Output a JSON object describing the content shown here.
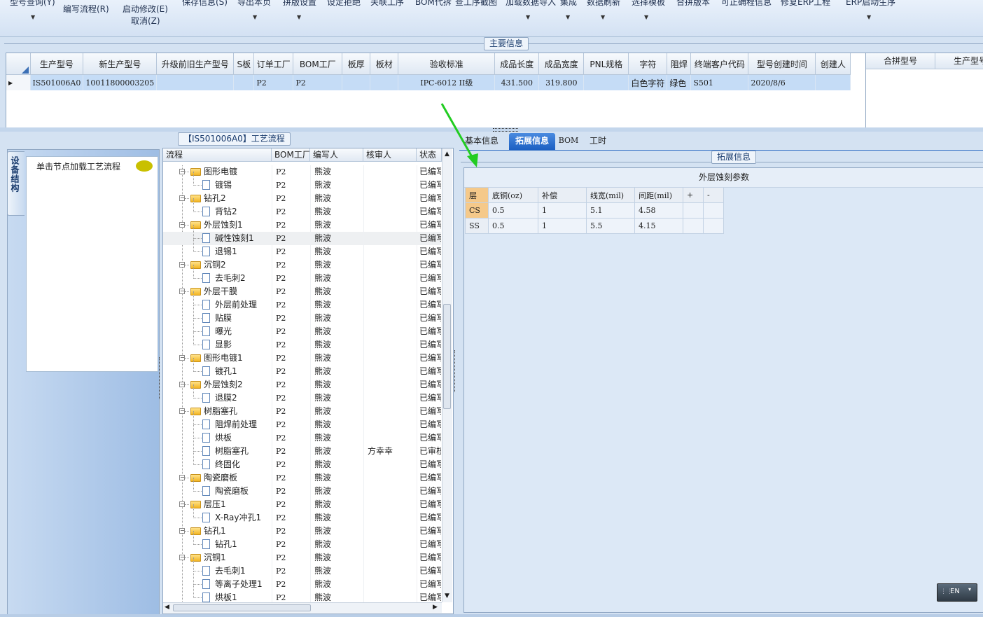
{
  "ribbon": {
    "top_items": [
      "型号查询(Y)",
      "保存信息(S)",
      "导出本页",
      "拼版设置",
      "设定拒绝",
      "关联工序",
      "BOM代拆",
      "查工序截图",
      "加载数据导入",
      "集成",
      "数据刷新",
      "选择模板",
      "合拼版本",
      "可正确程信息",
      "修复ERP工程",
      "ERP启动生序"
    ],
    "buttons": [
      {
        "label": "编写流程(R)"
      },
      {
        "label": "启动修改(E)",
        "sub": "取消(Z)"
      }
    ]
  },
  "main_info": {
    "title": "主要信息",
    "columns": [
      "生产型号",
      "新生产型号",
      "升级前旧生产型号",
      "S板",
      "订单工厂",
      "BOM工厂",
      "板厚",
      "板材",
      "验收标准",
      "成品长度",
      "成品宽度",
      "PNL规格",
      "字符",
      "阻焊",
      "终端客户代码",
      "型号创建时间",
      "创建人"
    ],
    "row": {
      "model": "IS501006A0",
      "new_model": "10011800003205",
      "old_model": "",
      "s_board": "",
      "order_factory": "P2",
      "bom_factory": "P2",
      "thickness": "",
      "material": "",
      "standard": "IPC-6012 II级",
      "length": "431.500",
      "width": "319.800",
      "pnl": "",
      "char": "白色字符",
      "mask": "绿色",
      "customer": "S501",
      "created": "2020/8/6",
      "creator": ""
    },
    "side_columns": [
      "合拼型号",
      "生产型号"
    ]
  },
  "left": {
    "vertical_tab": "设备结构",
    "hint": "单击节点加载工艺流程"
  },
  "process": {
    "title": "【IS501006A0】工艺流程",
    "columns": [
      "流程",
      "BOM工厂",
      "编写人",
      "核审人",
      "状态"
    ],
    "rows": [
      {
        "name": "图形电镀",
        "type": "folder",
        "bom": "P2",
        "writer": "熊波",
        "reviewer": "",
        "status": "已编写"
      },
      {
        "name": "镀锡",
        "type": "doc",
        "bom": "P2",
        "writer": "熊波",
        "reviewer": "",
        "status": "已编写"
      },
      {
        "name": "钻孔2",
        "type": "folder",
        "bom": "P2",
        "writer": "熊波",
        "reviewer": "",
        "status": "已编写"
      },
      {
        "name": "背钻2",
        "type": "doc",
        "bom": "P2",
        "writer": "熊波",
        "reviewer": "",
        "status": "已编写"
      },
      {
        "name": "外层蚀刻1",
        "type": "folder",
        "bom": "P2",
        "writer": "熊波",
        "reviewer": "",
        "status": "已编写"
      },
      {
        "name": "碱性蚀刻1",
        "type": "doc",
        "bom": "P2",
        "writer": "熊波",
        "reviewer": "",
        "status": "已编写"
      },
      {
        "name": "退锡1",
        "type": "doc",
        "bom": "P2",
        "writer": "熊波",
        "reviewer": "",
        "status": "已编写"
      },
      {
        "name": "沉铜2",
        "type": "folder",
        "bom": "P2",
        "writer": "熊波",
        "reviewer": "",
        "status": "已编写"
      },
      {
        "name": "去毛刺2",
        "type": "doc",
        "bom": "P2",
        "writer": "熊波",
        "reviewer": "",
        "status": "已编写"
      },
      {
        "name": "外层干膜",
        "type": "folder",
        "bom": "P2",
        "writer": "熊波",
        "reviewer": "",
        "status": "已编写"
      },
      {
        "name": "外层前处理",
        "type": "doc",
        "bom": "P2",
        "writer": "熊波",
        "reviewer": "",
        "status": "已编写"
      },
      {
        "name": "贴膜",
        "type": "doc",
        "bom": "P2",
        "writer": "熊波",
        "reviewer": "",
        "status": "已编写"
      },
      {
        "name": "曝光",
        "type": "doc",
        "bom": "P2",
        "writer": "熊波",
        "reviewer": "",
        "status": "已编写"
      },
      {
        "name": "显影",
        "type": "doc",
        "bom": "P2",
        "writer": "熊波",
        "reviewer": "",
        "status": "已编写"
      },
      {
        "name": "图形电镀1",
        "type": "folder",
        "bom": "P2",
        "writer": "熊波",
        "reviewer": "",
        "status": "已编写"
      },
      {
        "name": "镀孔1",
        "type": "doc",
        "bom": "P2",
        "writer": "熊波",
        "reviewer": "",
        "status": "已编写"
      },
      {
        "name": "外层蚀刻2",
        "type": "folder",
        "bom": "P2",
        "writer": "熊波",
        "reviewer": "",
        "status": "已编写"
      },
      {
        "name": "退膜2",
        "type": "doc",
        "bom": "P2",
        "writer": "熊波",
        "reviewer": "",
        "status": "已编写"
      },
      {
        "name": "树脂塞孔",
        "type": "folder",
        "bom": "P2",
        "writer": "熊波",
        "reviewer": "",
        "status": "已编写"
      },
      {
        "name": "阻焊前处理",
        "type": "doc",
        "bom": "P2",
        "writer": "熊波",
        "reviewer": "",
        "status": "已编写"
      },
      {
        "name": "烘板",
        "type": "doc",
        "bom": "P2",
        "writer": "熊波",
        "reviewer": "",
        "status": "已编写"
      },
      {
        "name": "树脂塞孔",
        "type": "doc",
        "bom": "P2",
        "writer": "熊波",
        "reviewer": "方幸幸",
        "status": "已审核"
      },
      {
        "name": "终固化",
        "type": "doc",
        "bom": "P2",
        "writer": "熊波",
        "reviewer": "",
        "status": "已编写"
      },
      {
        "name": "陶瓷磨板",
        "type": "folder",
        "bom": "P2",
        "writer": "熊波",
        "reviewer": "",
        "status": "已编写"
      },
      {
        "name": "陶瓷磨板",
        "type": "doc",
        "bom": "P2",
        "writer": "熊波",
        "reviewer": "",
        "status": "已编写"
      },
      {
        "name": "层压1",
        "type": "folder",
        "bom": "P2",
        "writer": "熊波",
        "reviewer": "",
        "status": "已编写"
      },
      {
        "name": "X-Ray冲孔1",
        "type": "doc",
        "bom": "P2",
        "writer": "熊波",
        "reviewer": "",
        "status": "已编写"
      },
      {
        "name": "钻孔1",
        "type": "folder",
        "bom": "P2",
        "writer": "熊波",
        "reviewer": "",
        "status": "已编写"
      },
      {
        "name": "钻孔1",
        "type": "doc",
        "bom": "P2",
        "writer": "熊波",
        "reviewer": "",
        "status": "已编写"
      },
      {
        "name": "沉铜1",
        "type": "folder",
        "bom": "P2",
        "writer": "熊波",
        "reviewer": "",
        "status": "已编写"
      },
      {
        "name": "去毛刺1",
        "type": "doc",
        "bom": "P2",
        "writer": "熊波",
        "reviewer": "",
        "status": "已编写"
      },
      {
        "name": "等离子处理1",
        "type": "doc",
        "bom": "P2",
        "writer": "熊波",
        "reviewer": "",
        "status": "已编写"
      },
      {
        "name": "烘板1",
        "type": "doc",
        "bom": "P2",
        "writer": "熊波",
        "reviewer": "",
        "status": "已编写"
      }
    ]
  },
  "tabs": [
    "基本信息",
    "拓展信息",
    "BOM",
    "工时"
  ],
  "active_tab": "拓展信息",
  "ext": {
    "group_title": "拓展信息",
    "section_title": "外层蚀刻参数",
    "headers": [
      "层",
      "底铜(oz)",
      "补偿",
      "线宽(mil)",
      "间距(mil)",
      "+",
      "-"
    ],
    "rows": [
      [
        "CS",
        "0.5",
        "1",
        "5.1",
        "4.58",
        "",
        ""
      ],
      [
        "SS",
        "0.5",
        "1",
        "5.5",
        "4.15",
        "",
        ""
      ]
    ]
  },
  "ime": {
    "label": "EN"
  },
  "colors": {
    "accent": "#1c5fc2",
    "selected_row": "#c5dcf6",
    "arrow": "#22cc22"
  }
}
